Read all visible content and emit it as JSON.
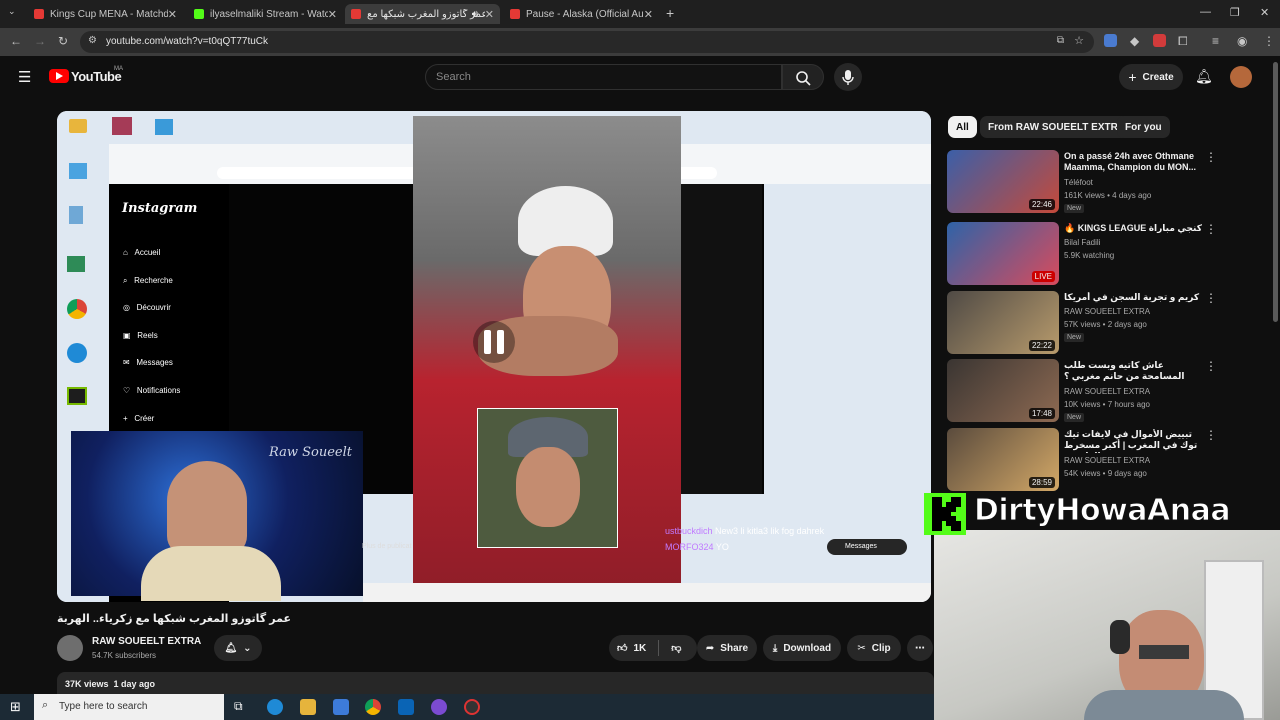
{
  "browser": {
    "tabs": [
      {
        "title": "Kings Cup MENA - Matchda",
        "active": false,
        "color": "#e53935"
      },
      {
        "title": "ilyaselmaliki Stream - Watch Li",
        "active": false,
        "color": "#53fc18"
      },
      {
        "title": "عمر گاتوزو المغرب شبكها مع",
        "active": true,
        "color": "#e53935"
      },
      {
        "title": "Pause - Alaska (Official Audio)",
        "active": false,
        "color": "#e53935"
      }
    ],
    "url": "youtube.com/watch?v=t0qQT77tuCk"
  },
  "youtube": {
    "logo_text": "YouTube",
    "country_code": "MA",
    "search_placeholder": "Search",
    "create_label": "Create"
  },
  "video": {
    "title": "عمر گاتوزو المغرب شبكها مع زكرياء.. الهربة",
    "channel_name": "RAW SOUEELT EXTRA",
    "subscribers": "54.7K subscribers",
    "likes": "1K",
    "share_label": "Share",
    "download_label": "Download",
    "clip_label": "Clip",
    "views_date": "37K views  1 day ago",
    "inner": {
      "instagram_logo": "Instagram",
      "menu": [
        "Accueil",
        "Recherche",
        "Découvrir",
        "Reels",
        "Messages",
        "Notifications",
        "Créer"
      ],
      "chat_user1": "ustbuckdich",
      "chat_msg1": "New3 li kitla3 lik fog dahrek",
      "chat_user2": "MORFO324",
      "chat_msg2": "YO",
      "messages_label": "Messages",
      "raw_watermark": "Raw Soueelt",
      "plus_label": "Plus de publicat"
    }
  },
  "sidebar": {
    "chips": [
      "All",
      "From RAW SOUEELT EXTRA",
      "For you"
    ],
    "recs": [
      {
        "title": "On a passé 24h avec Othmane Maamma, Champion du MON...",
        "channel": "Téléfoot",
        "views": "161K views • 4 days ago",
        "badge": "New",
        "duration": "22:46"
      },
      {
        "title": "🔥 KINGS LEAGUE كنجي مباراة",
        "channel": "Bilal Fadili",
        "views": "5.9K watching",
        "badge": "",
        "duration": "LIVE"
      },
      {
        "title": "كريم و تجربة السجن في أمريكا",
        "channel": "RAW SOUEELT EXTRA",
        "views": "57K views • 2 days ago",
        "badge": "New",
        "duration": "22:22"
      },
      {
        "title": "عاش كاتيه وبست طلب المسامحة من حانم مغربي ؟",
        "channel": "RAW SOUEELT EXTRA",
        "views": "10K views • 7 hours ago",
        "badge": "New",
        "duration": "17:48"
      },
      {
        "title": "تبييض الأموال في لايفات تيك توك في المغرب | أكبر مسخرط الواقبين",
        "channel": "RAW SOUEELT EXTRA",
        "views": "54K views • 9 days ago",
        "badge": "",
        "duration": "28:59"
      }
    ]
  },
  "overlay": {
    "streamer_name": "DirtyHowaAnaa"
  },
  "taskbar": {
    "search_placeholder": "Type here to search"
  }
}
